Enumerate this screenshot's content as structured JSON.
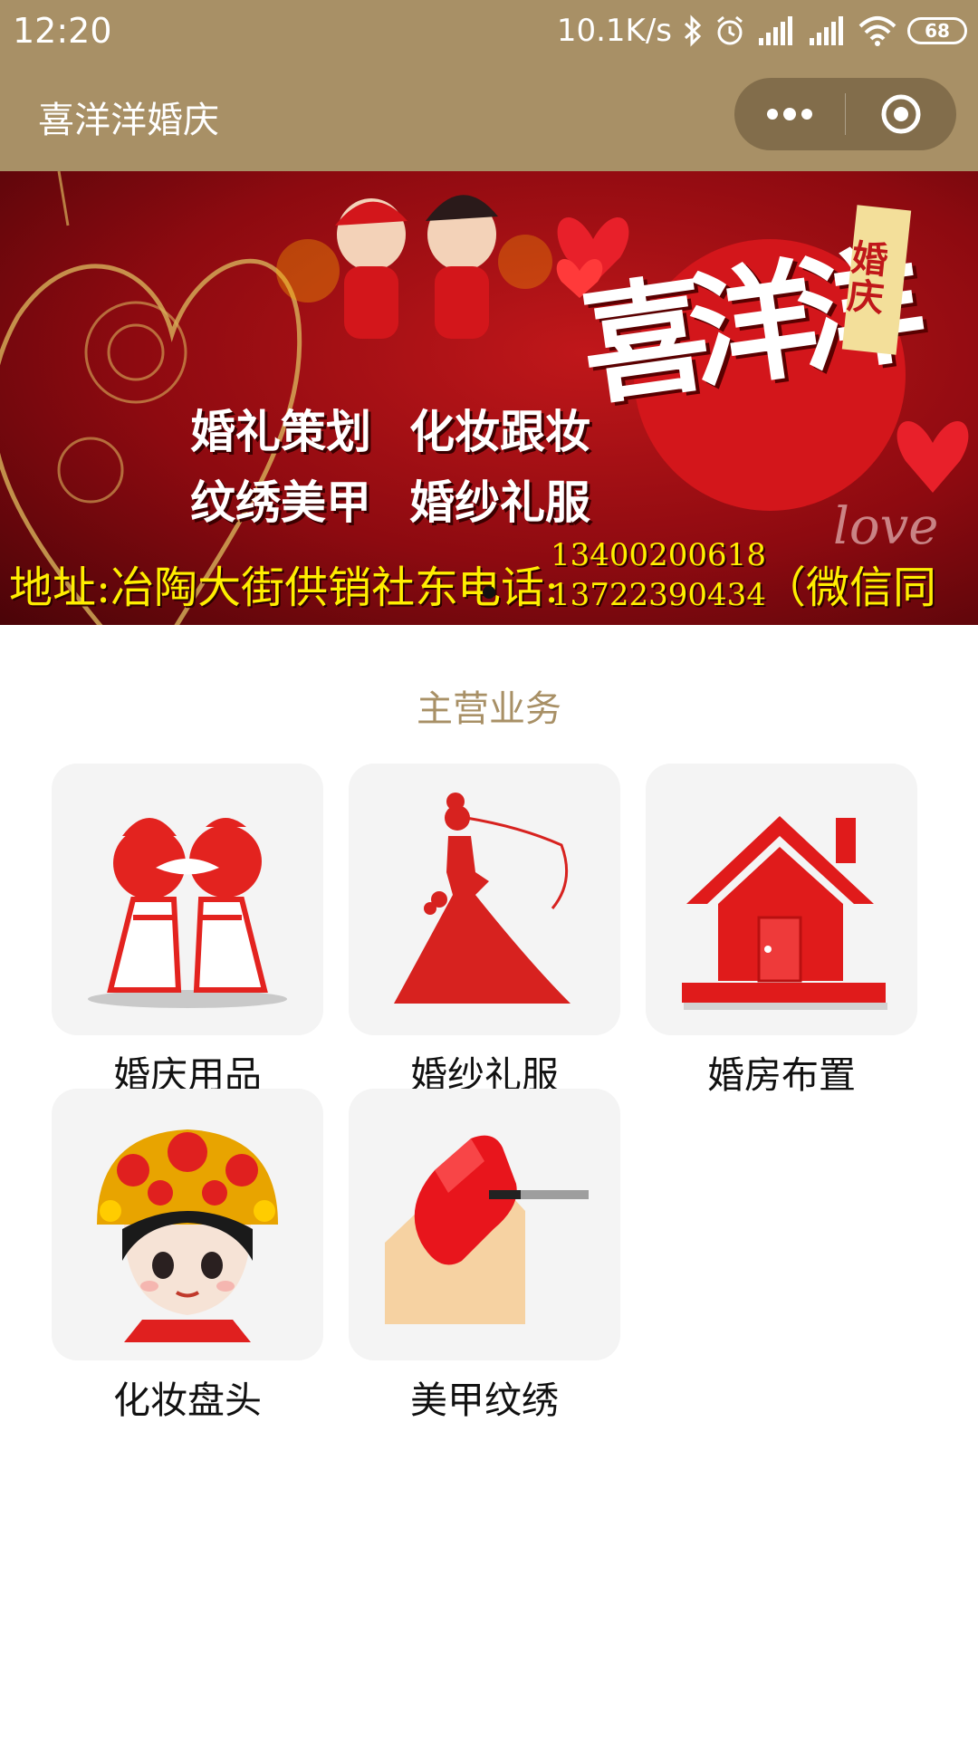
{
  "status_bar": {
    "time": "12:20",
    "network_speed": "10.1K/s",
    "battery": "68"
  },
  "nav": {
    "title": "喜洋洋婚庆"
  },
  "banner": {
    "brand_big": "喜洋洋",
    "brand_tag": "婚庆",
    "slogans": [
      "婚礼策划",
      "化妆跟妆",
      "纹绣美甲",
      "婚纱礼服"
    ],
    "address": "地址:冶陶大街供销社东",
    "phone_label": "电话:",
    "phones": [
      "13400200618",
      "13722390434"
    ],
    "wechat_note": "（微信同号）",
    "love_script": "love"
  },
  "section": {
    "title": "主营业务"
  },
  "services": [
    {
      "label": "婚庆用品",
      "icon": "kissing-couple-icon"
    },
    {
      "label": "婚纱礼服",
      "icon": "bride-dress-icon"
    },
    {
      "label": "婚房布置",
      "icon": "house-icon"
    },
    {
      "label": "化妆盘头",
      "icon": "bride-headdress-icon"
    },
    {
      "label": "美甲纹绣",
      "icon": "nail-polish-icon"
    }
  ],
  "colors": {
    "header": "#a89066",
    "accent_red": "#c0171a",
    "section_title": "#a89066",
    "banner_yellow": "#ffee00"
  }
}
